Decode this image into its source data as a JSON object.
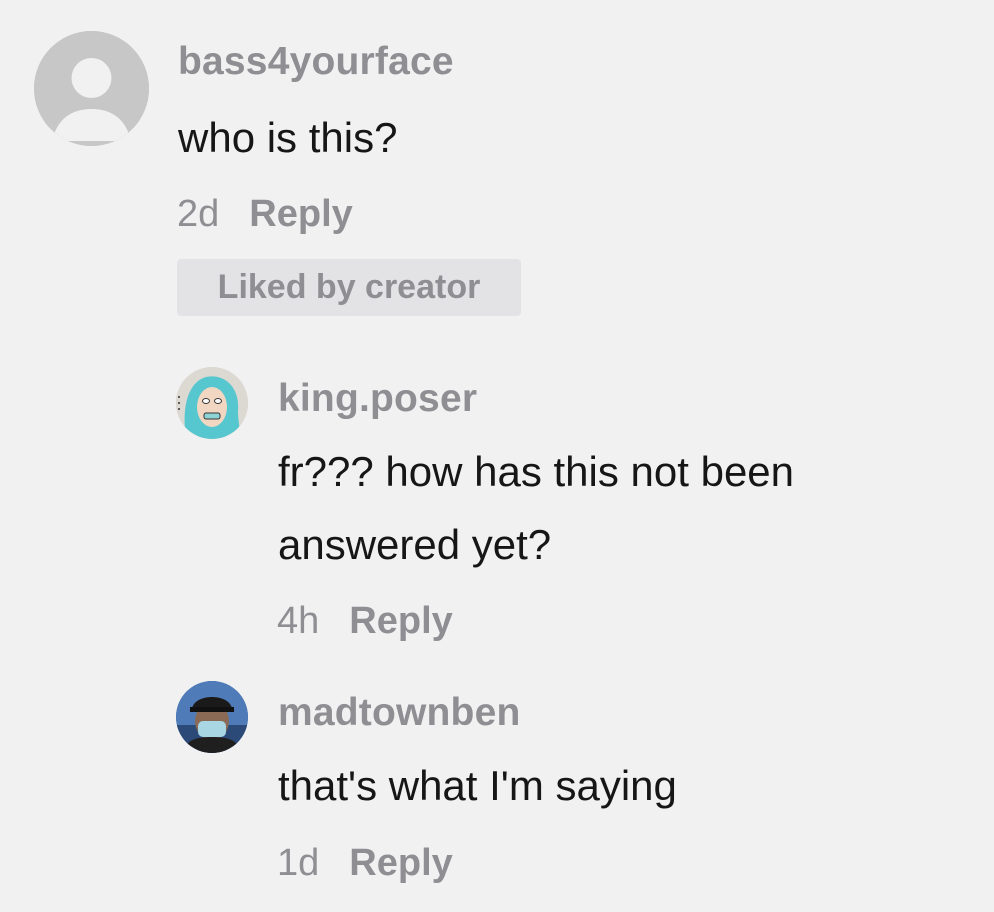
{
  "comments": [
    {
      "username": "bass4yourface",
      "text_lines": [
        "who is this?"
      ],
      "age": "2d",
      "reply_label": "Reply",
      "badge": "Liked by creator",
      "avatar_icon": "default-user-icon"
    }
  ],
  "replies": [
    {
      "username": "king.poser",
      "text_lines": [
        "fr??? how has this not been",
        "answered yet?"
      ],
      "age": "4h",
      "reply_label": "Reply",
      "avatar_icon": "cartoon-face-avatar"
    },
    {
      "username": "madtownben",
      "text_lines": [
        "that's what I'm saying"
      ],
      "age": "1d",
      "reply_label": "Reply",
      "avatar_icon": "photo-avatar"
    }
  ],
  "colors": {
    "background": "#f2f1f2",
    "username": "#8f8e92",
    "text": "#161616",
    "badge_bg": "#e3e2e4"
  }
}
